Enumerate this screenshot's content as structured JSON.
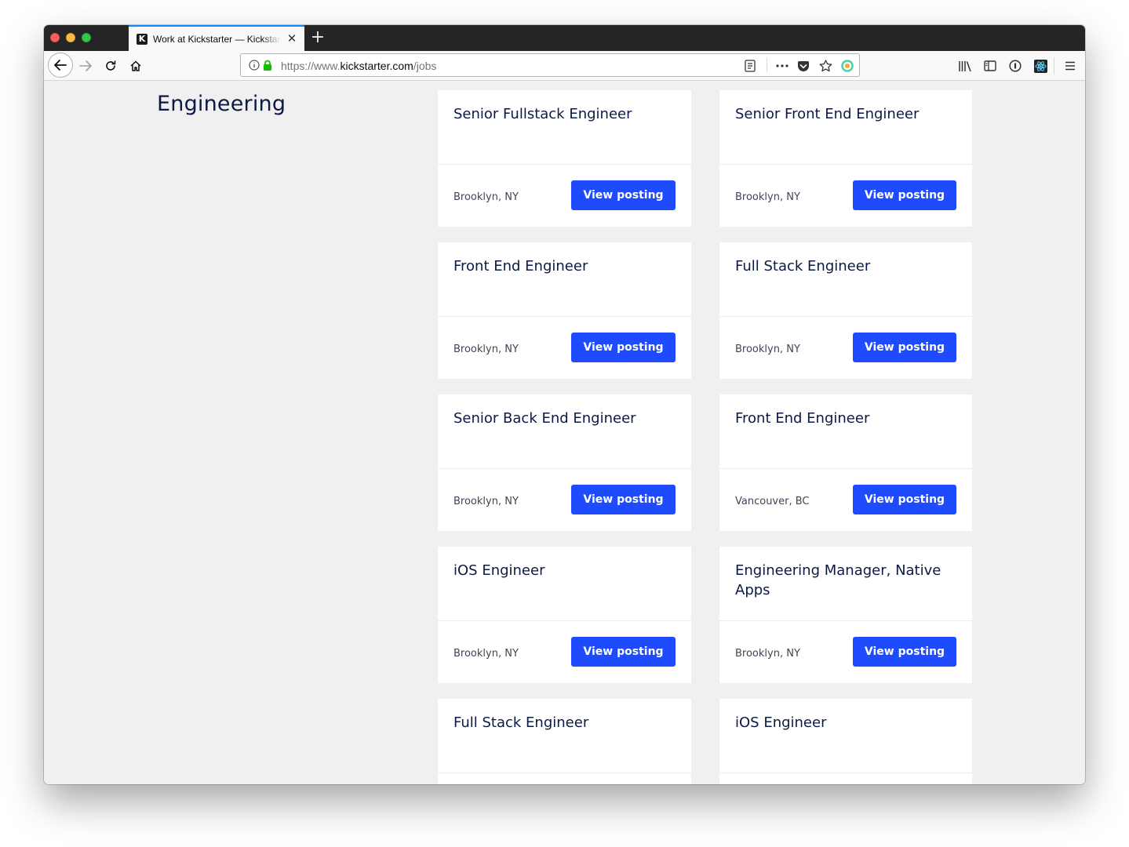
{
  "browser": {
    "tab_title": "Work at Kickstarter — Kickstarter",
    "tab_favicon": "K",
    "new_tab_glyph": "+",
    "url_scheme": "https://www.",
    "url_host": "kickstarter.com",
    "url_path": "/jobs",
    "accent": "#0a84ff"
  },
  "page": {
    "section_title": "Engineering",
    "button_color": "#1f4bff",
    "jobs": [
      {
        "title": "Senior Fullstack Engineer",
        "location": "Brooklyn, NY",
        "button": "View posting"
      },
      {
        "title": "Senior Front End Engineer",
        "location": "Brooklyn, NY",
        "button": "View posting"
      },
      {
        "title": "Front End Engineer",
        "location": "Brooklyn, NY",
        "button": "View posting"
      },
      {
        "title": "Full Stack Engineer",
        "location": "Brooklyn, NY",
        "button": "View posting"
      },
      {
        "title": "Senior Back End Engineer",
        "location": "Brooklyn, NY",
        "button": "View posting"
      },
      {
        "title": "Front End Engineer",
        "location": "Vancouver, BC",
        "button": "View posting"
      },
      {
        "title": "iOS Engineer",
        "location": "Brooklyn, NY",
        "button": "View posting"
      },
      {
        "title": "Engineering Manager, Native Apps",
        "location": "Brooklyn, NY",
        "button": "View posting"
      },
      {
        "title": "Full Stack Engineer",
        "location": "",
        "button": ""
      },
      {
        "title": "iOS Engineer",
        "location": "",
        "button": ""
      }
    ]
  }
}
